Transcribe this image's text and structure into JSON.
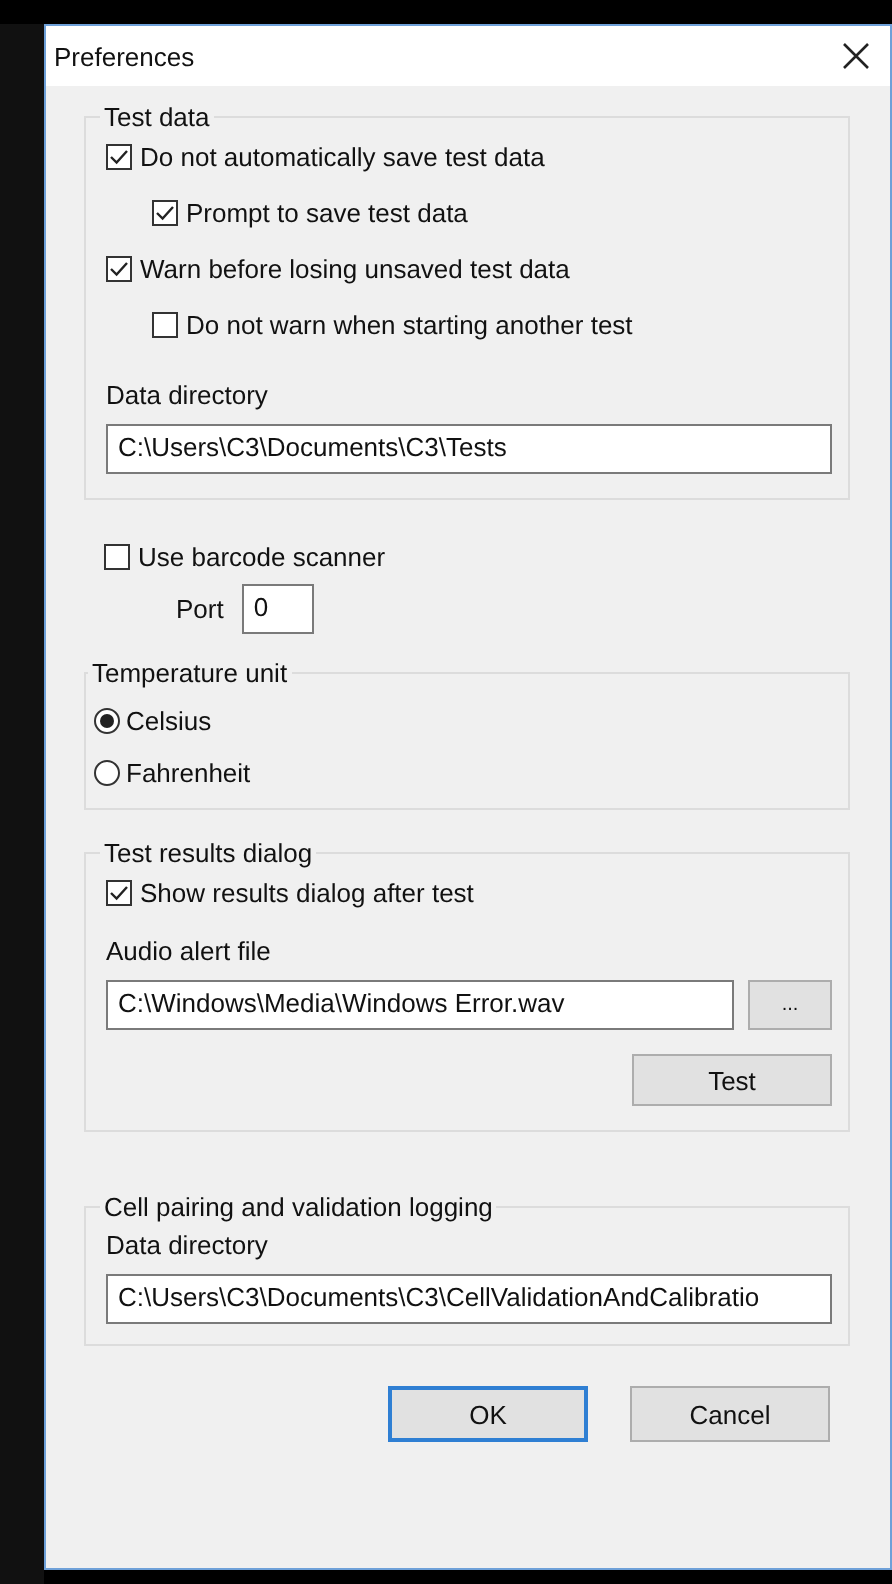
{
  "window": {
    "title": "Preferences"
  },
  "test_data": {
    "title": "Test data",
    "options": [
      {
        "label": "Do not automatically save test data",
        "checked": true,
        "children": [
          {
            "label": "Prompt to save test data",
            "checked": true
          }
        ]
      },
      {
        "label": "Warn before losing unsaved test data",
        "checked": true,
        "children": [
          {
            "label": "Do not warn when starting another test",
            "checked": false
          }
        ]
      }
    ],
    "directory_label": "Data directory",
    "directory": "C:\\Users\\C3\\Documents\\C3\\Tests"
  },
  "barcode": {
    "label": "Use barcode scanner",
    "checked": false,
    "port_label": "Port",
    "port": "0"
  },
  "temperature": {
    "title": "Temperature unit",
    "options": [
      {
        "label": "Celsius",
        "selected": true
      },
      {
        "label": "Fahrenheit",
        "selected": false
      }
    ]
  },
  "results": {
    "title": "Test results dialog",
    "show": {
      "label": "Show results dialog after test",
      "checked": true
    },
    "audio_label": "Audio alert file",
    "audio_file": "C:\\Windows\\Media\\Windows Error.wav",
    "browse": "...",
    "test": "Test"
  },
  "logging": {
    "title": "Cell pairing and validation logging",
    "directory_label": "Data directory",
    "directory": "C:\\Users\\C3\\Documents\\C3\\CellValidationAndCalibratio"
  },
  "buttons": [
    {
      "label": "OK",
      "default": true
    },
    {
      "label": "Cancel",
      "default": false
    }
  ]
}
